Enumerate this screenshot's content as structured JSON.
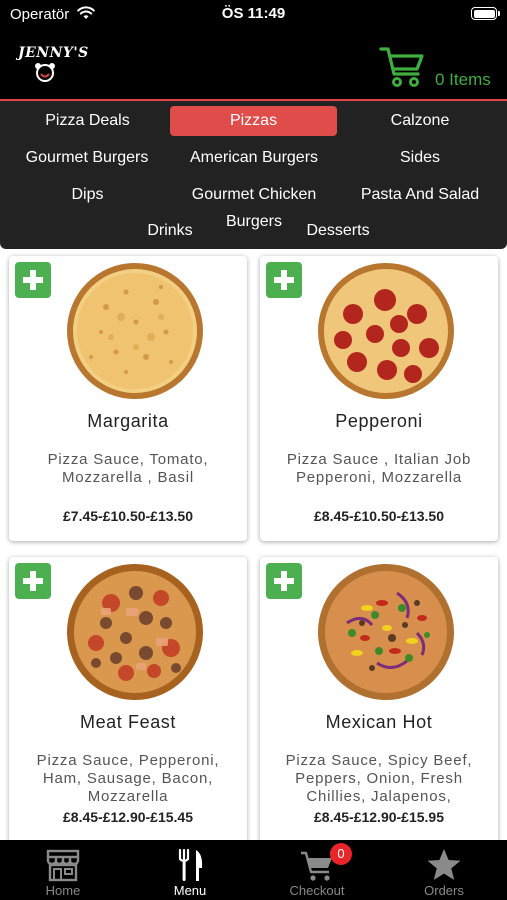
{
  "status_bar": {
    "carrier": "Operatör",
    "time": "ÖS 11:49"
  },
  "header": {
    "logo_text": "JENNY'S",
    "cart_label": "0 Items",
    "colors": {
      "accent_green": "#3fae3f",
      "accent_red": "#e04848"
    }
  },
  "categories": [
    {
      "label": "Pizza Deals",
      "active": false
    },
    {
      "label": "Pizzas",
      "active": true
    },
    {
      "label": "Calzone",
      "active": false
    },
    {
      "label": "Gourmet Burgers",
      "active": false
    },
    {
      "label": "American Burgers",
      "active": false
    },
    {
      "label": "Sides",
      "active": false
    },
    {
      "label": "Dips",
      "active": false
    },
    {
      "label": "Gourmet Chicken",
      "active": false
    },
    {
      "label": "Pasta And Salad",
      "active": false
    },
    {
      "label": "Drinks",
      "active": false
    },
    {
      "label": "Burgers",
      "active": false
    },
    {
      "label": "Desserts",
      "active": false
    }
  ],
  "products": [
    {
      "name": "Margarita",
      "description": "Pizza Sauce, Tomato, Mozzarella , Basil",
      "price": "£7.45-£10.50-£13.50",
      "icon": "plain-cheese-pizza"
    },
    {
      "name": "Pepperoni",
      "description": "Pizza Sauce , Italian Job Pepperoni, Mozzarella",
      "price": "£8.45-£10.50-£13.50",
      "icon": "pepperoni-pizza"
    },
    {
      "name": "Meat Feast",
      "description": "Pizza Sauce, Pepperoni, Ham, Sausage, Bacon, Mozzarella",
      "price": "£8.45-£12.90-£15.45",
      "icon": "meat-pizza"
    },
    {
      "name": "Mexican Hot",
      "description": "Pizza Sauce, Spicy Beef, Peppers, Onion, Fresh Chillies, Jalapenos,",
      "price": "£8.45-£12.90-£15.95",
      "icon": "veggie-pizza"
    }
  ],
  "tabbar": {
    "tabs": [
      {
        "label": "Home",
        "icon": "storefront-icon",
        "active": false
      },
      {
        "label": "Menu",
        "icon": "fork-knife-icon",
        "active": true
      },
      {
        "label": "Checkout",
        "icon": "cart-icon",
        "active": false
      },
      {
        "label": "Orders",
        "icon": "star-icon",
        "active": false
      }
    ],
    "checkout_badge": "0"
  }
}
